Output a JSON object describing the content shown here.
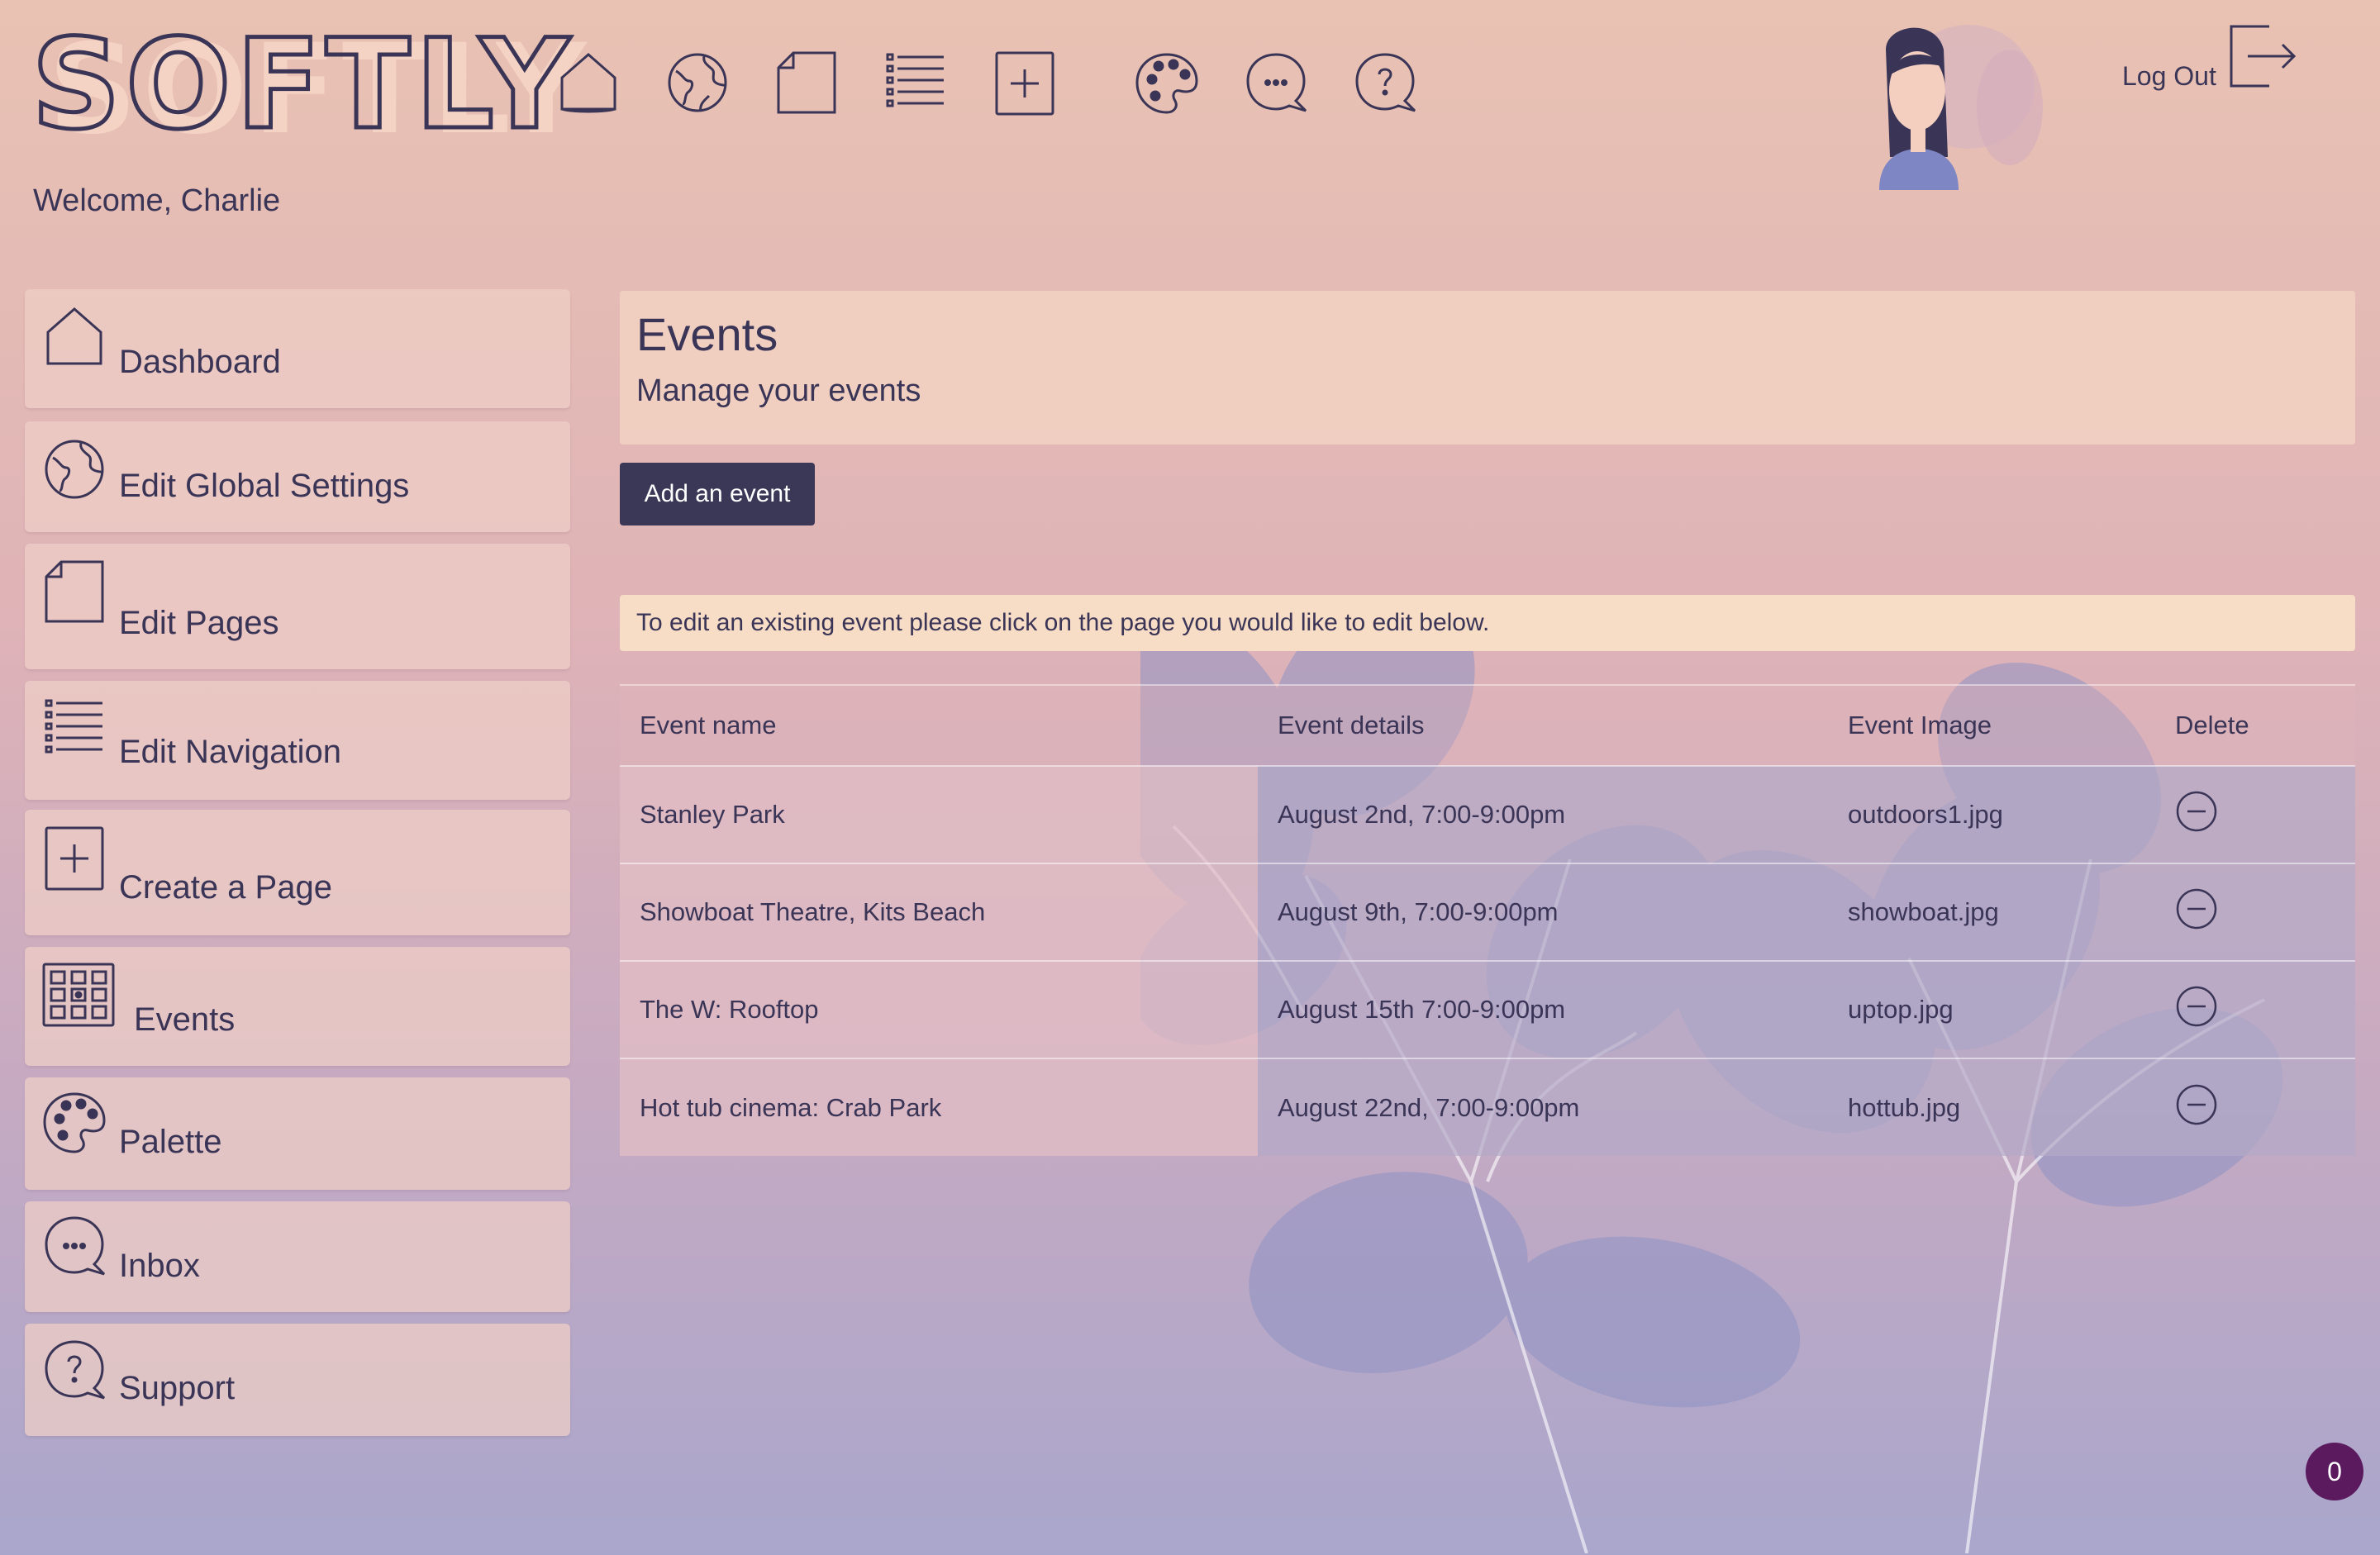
{
  "header": {
    "logo_text": "SOFTLY",
    "welcome": "Welcome, Charlie",
    "logout_label": "Log Out",
    "icons": [
      "home-icon",
      "globe-icon",
      "page-icon",
      "list-icon",
      "plus-box-icon",
      "palette-icon",
      "chat-icon",
      "help-icon"
    ]
  },
  "sidebar": {
    "items": [
      {
        "label": "Dashboard",
        "icon": "home-icon"
      },
      {
        "label": "Edit Global Settings",
        "icon": "globe-icon"
      },
      {
        "label": "Edit Pages",
        "icon": "page-icon"
      },
      {
        "label": "Edit Navigation",
        "icon": "list-icon"
      },
      {
        "label": "Create a Page",
        "icon": "plus-box-icon"
      },
      {
        "label": "Events",
        "icon": "calendar-grid-icon"
      },
      {
        "label": "Palette",
        "icon": "palette-icon"
      },
      {
        "label": "Inbox",
        "icon": "chat-icon"
      },
      {
        "label": "Support",
        "icon": "help-icon"
      }
    ]
  },
  "main": {
    "title": "Events",
    "subtitle": "Manage your events",
    "add_button": "Add an event",
    "info": "To edit an existing event please click on the page you would like to edit below.",
    "table": {
      "headers": [
        "Event name",
        "Event details",
        "Event Image",
        "Delete"
      ],
      "rows": [
        {
          "name": "Stanley Park",
          "details": "August 2nd, 7:00-9:00pm",
          "image": "outdoors1.jpg"
        },
        {
          "name": "Showboat Theatre, Kits Beach",
          "details": "August 9th, 7:00-9:00pm",
          "image": "showboat.jpg"
        },
        {
          "name": "The W: Rooftop",
          "details": "August 15th 7:00-9:00pm",
          "image": "uptop.jpg"
        },
        {
          "name": "Hot tub cinema: Crab Park",
          "details": "August 22nd, 7:00-9:00pm",
          "image": "hottub.jpg"
        }
      ]
    }
  },
  "badge": {
    "count": "0"
  },
  "colors": {
    "dark": "#3b3756",
    "badge": "#5b1a5e",
    "info_bg": "#f7dcc6"
  }
}
